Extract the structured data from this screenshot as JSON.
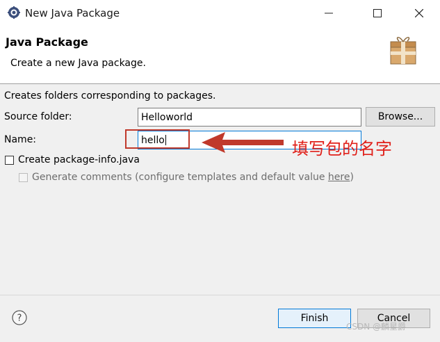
{
  "window": {
    "title": "New Java Package",
    "controls": {
      "minimize": "minimize",
      "maximize": "maximize",
      "close": "close"
    }
  },
  "header": {
    "title": "Java Package",
    "description": "Create a new Java package.",
    "icon": "package-icon"
  },
  "form": {
    "intro": "Creates folders corresponding to packages.",
    "source_folder_label": "Source folder:",
    "source_folder_value": "Helloworld",
    "browse_label": "Browse...",
    "name_label": "Name:",
    "name_value": "hello",
    "create_package_info_label": "Create package-info.java",
    "create_package_info_checked": false,
    "generate_comments_prefix": "Generate comments (configure templates and default value ",
    "generate_comments_link": "here",
    "generate_comments_suffix": ")",
    "generate_comments_enabled": false
  },
  "annotation": {
    "text": "填写包的名字",
    "color": "#e0201a"
  },
  "footer": {
    "help_icon": "help-icon",
    "finish_label": "Finish",
    "cancel_label": "Cancel"
  },
  "watermark": "CSDN @麟星爵"
}
